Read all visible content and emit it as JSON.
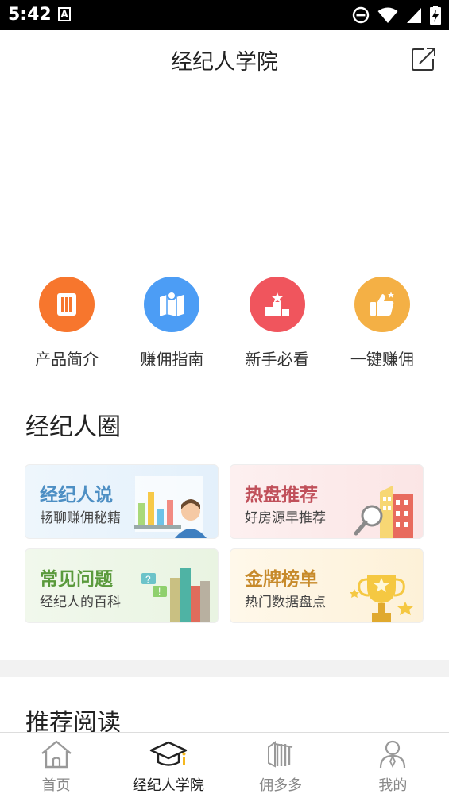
{
  "status": {
    "time": "5:42",
    "a_icon": "A"
  },
  "header": {
    "title": "经纪人学院"
  },
  "quicknav": [
    {
      "label": "产品简介",
      "icon": "product-book-icon",
      "color": "#f7762d"
    },
    {
      "label": "赚佣指南",
      "icon": "map-pin-icon",
      "color": "#4c9df5"
    },
    {
      "label": "新手必看",
      "icon": "podium-icon",
      "color": "#f0555d"
    },
    {
      "label": "一键赚佣",
      "icon": "thumbs-up-icon",
      "color": "#f4b045"
    }
  ],
  "circle": {
    "title": "经纪人圈",
    "cards": [
      {
        "title": "经纪人说",
        "subtitle": "畅聊赚佣秘籍",
        "title_color": "#4d8fc4"
      },
      {
        "title": "热盘推荐",
        "subtitle": "好房源早推荐",
        "title_color": "#c0505a"
      },
      {
        "title": "常见问题",
        "subtitle": "经纪人的百科",
        "title_color": "#5a9a3c"
      },
      {
        "title": "金牌榜单",
        "subtitle": "热门数据盘点",
        "title_color": "#c78a2a"
      }
    ]
  },
  "recommend": {
    "title": "推荐阅读"
  },
  "tabs": [
    {
      "label": "首页",
      "icon": "home-icon",
      "active": false
    },
    {
      "label": "经纪人学院",
      "icon": "graduation-cap-icon",
      "active": true
    },
    {
      "label": "佣多多",
      "icon": "building-logo-icon",
      "active": false
    },
    {
      "label": "我的",
      "icon": "person-icon",
      "active": false
    }
  ]
}
